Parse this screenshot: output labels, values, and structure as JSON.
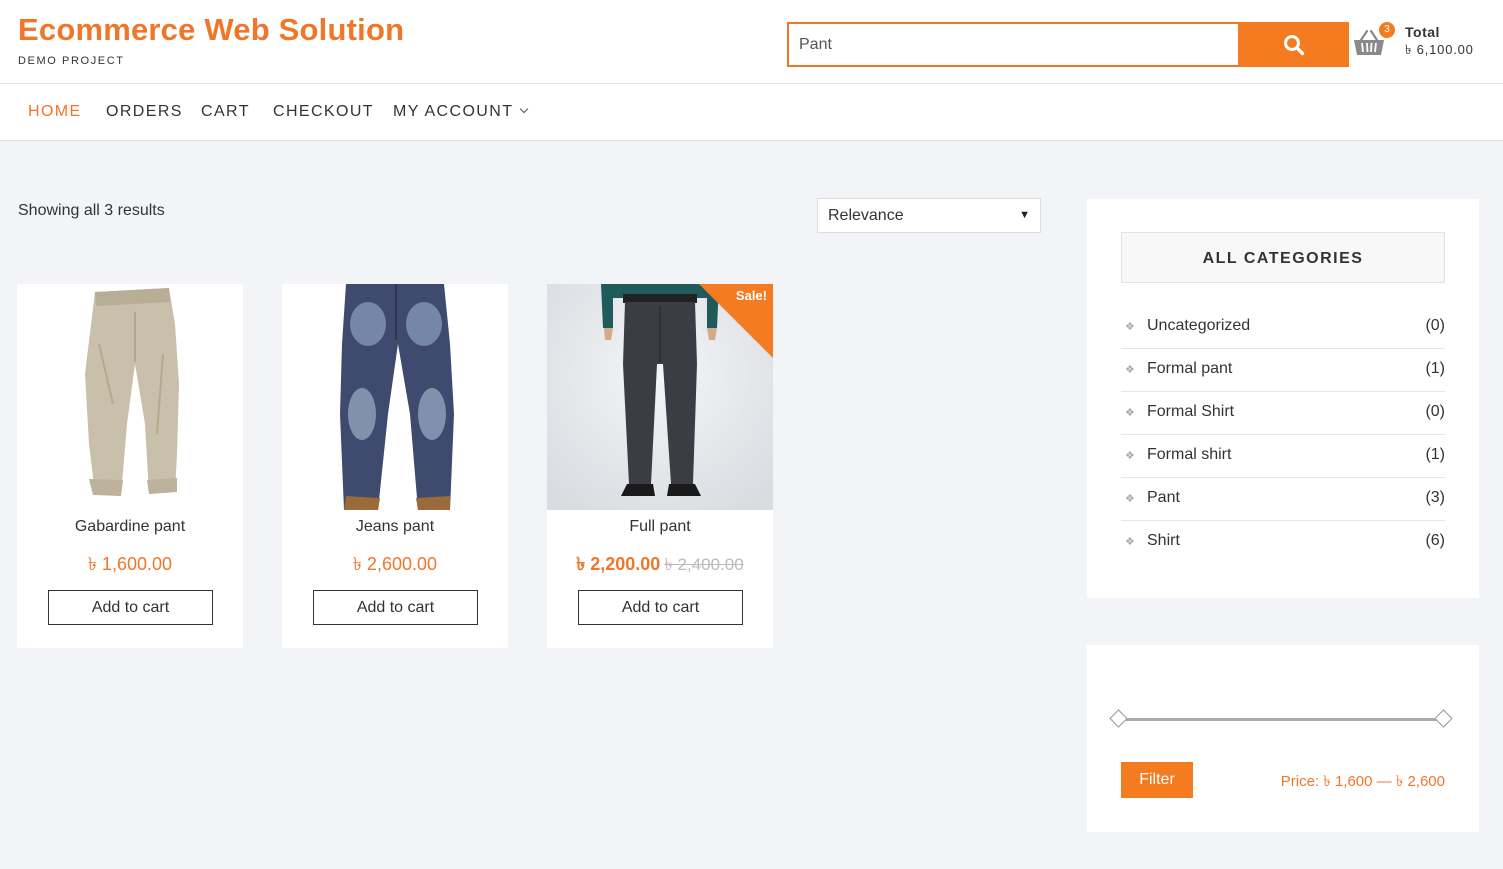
{
  "header": {
    "site_title": "Ecommerce Web Solution",
    "tagline": "DEMO PROJECT",
    "search_value": "Pant",
    "cart_count": "3",
    "cart_total_label": "Total",
    "cart_total_value": "৳ 6,100.00",
    "accent_color": "#f47b20"
  },
  "nav": {
    "items": [
      "HOME",
      "ORDERS",
      "CART",
      "CHECKOUT",
      "MY ACCOUNT"
    ]
  },
  "main": {
    "result_count": "Showing all 3 results",
    "sort_selected": "Relevance",
    "products": [
      {
        "name": "Gabardine pant",
        "price": "৳ 1,600.00",
        "button": "Add to cart"
      },
      {
        "name": "Jeans pant",
        "price": "৳ 2,600.00",
        "button": "Add to cart"
      },
      {
        "name": "Full pant",
        "price": "৳ 2,200.00",
        "old_price": "৳ 2,400.00",
        "badge": "Sale!",
        "button": "Add to cart"
      }
    ]
  },
  "sidebar": {
    "categories_title": "ALL CATEGORIES",
    "categories": [
      {
        "name": "Uncategorized",
        "count": "(0)"
      },
      {
        "name": "Formal pant",
        "count": "(1)"
      },
      {
        "name": "Formal Shirt",
        "count": "(0)"
      },
      {
        "name": "Formal shirt",
        "count": "(1)"
      },
      {
        "name": "Pant",
        "count": "(3)"
      },
      {
        "name": "Shirt",
        "count": "(6)"
      }
    ],
    "filter_button": "Filter",
    "price_range": "Price: ৳ 1,600 — ৳ 2,600"
  }
}
